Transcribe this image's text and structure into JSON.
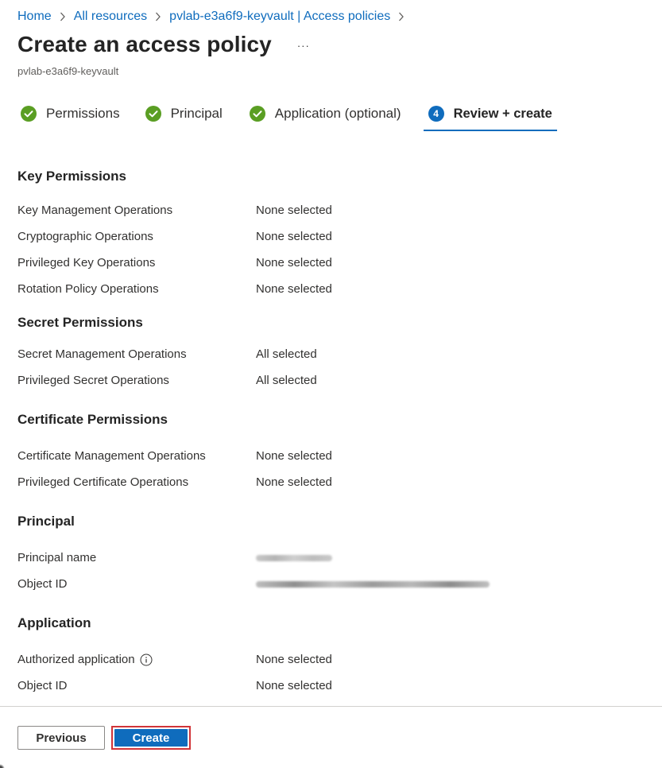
{
  "breadcrumb": {
    "items": [
      "Home",
      "All resources",
      "pvlab-e3a6f9-keyvault | Access policies"
    ]
  },
  "header": {
    "title": "Create an access policy",
    "more_label": "···",
    "subtitle": "pvlab-e3a6f9-keyvault"
  },
  "steps": [
    {
      "label": "Permissions",
      "state": "complete"
    },
    {
      "label": "Principal",
      "state": "complete"
    },
    {
      "label": "Application (optional)",
      "state": "complete"
    },
    {
      "label": "Review + create",
      "number": "4",
      "state": "active"
    }
  ],
  "sections": {
    "key": {
      "heading": "Key Permissions",
      "rows": [
        {
          "key": "Key Management Operations",
          "value": "None selected"
        },
        {
          "key": "Cryptographic Operations",
          "value": "None selected"
        },
        {
          "key": "Privileged Key Operations",
          "value": "None selected"
        },
        {
          "key": "Rotation Policy Operations",
          "value": "None selected"
        }
      ]
    },
    "secret": {
      "heading": "Secret Permissions",
      "rows": [
        {
          "key": "Secret Management Operations",
          "value": "All selected"
        },
        {
          "key": "Privileged Secret Operations",
          "value": "All selected"
        }
      ]
    },
    "certificate": {
      "heading": "Certificate Permissions",
      "rows": [
        {
          "key": "Certificate Management Operations",
          "value": "None selected"
        },
        {
          "key": "Privileged Certificate Operations",
          "value": "None selected"
        }
      ]
    },
    "principal": {
      "heading": "Principal",
      "rows": [
        {
          "key": "Principal name"
        },
        {
          "key": "Object ID"
        }
      ]
    },
    "application": {
      "heading": "Application",
      "rows": [
        {
          "key": "Authorized application",
          "value": "None selected"
        },
        {
          "key": "Object ID",
          "value": "None selected"
        }
      ]
    }
  },
  "footer": {
    "previous_label": "Previous",
    "create_label": "Create"
  },
  "colors": {
    "accent": "#0f6cbd",
    "success": "#107c10",
    "highlight_outline": "#d13438"
  },
  "icons": {
    "step_complete": "check-circle-icon",
    "breadcrumb_separator": "chevron-right-icon",
    "info": "info-icon",
    "more": "more-horizontal-icon"
  }
}
